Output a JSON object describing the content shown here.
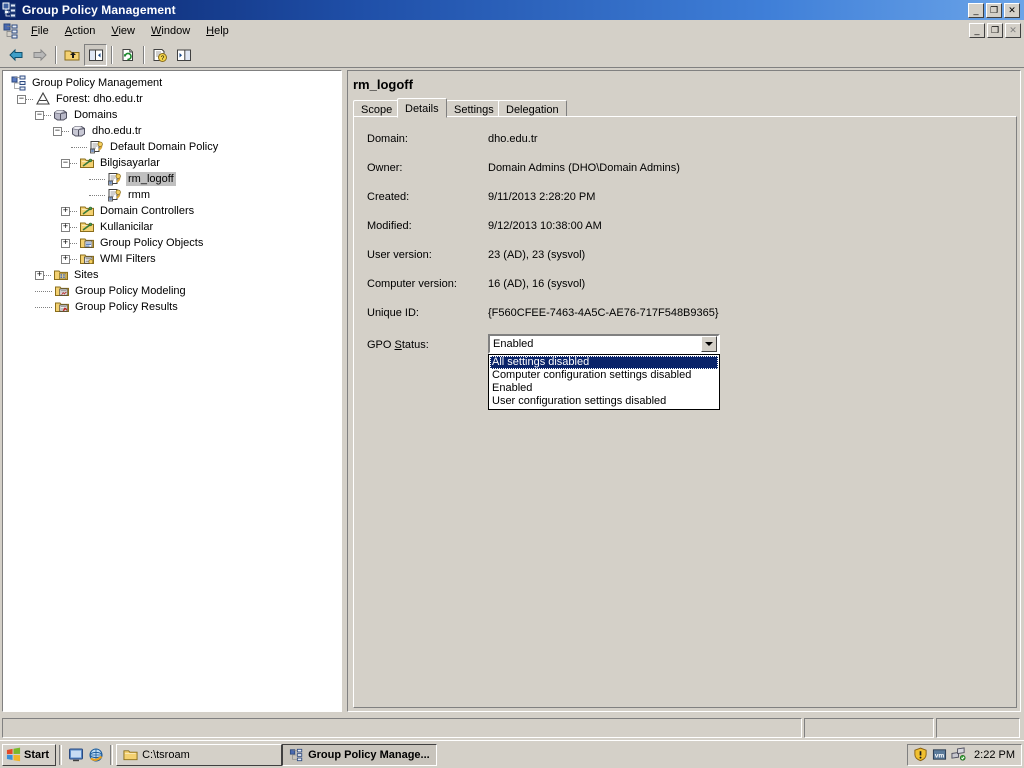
{
  "window": {
    "title": "Group Policy Management",
    "icon": "gpmc-icon",
    "controls": {
      "minimize": "_",
      "maximize": "❐",
      "close": "✕"
    }
  },
  "mdi_controls": {
    "minimize": "_",
    "maximize": "❐",
    "close": "✕"
  },
  "menu": {
    "icon": "gpmc-small-icon",
    "items": [
      {
        "label": "File",
        "accel": "F"
      },
      {
        "label": "Action",
        "accel": "A"
      },
      {
        "label": "View",
        "accel": "V"
      },
      {
        "label": "Window",
        "accel": "W"
      },
      {
        "label": "Help",
        "accel": "H"
      }
    ]
  },
  "toolbar": {
    "buttons": [
      {
        "name": "back-button",
        "icon": "arrow-left-icon",
        "enabled": true,
        "pressed": false
      },
      {
        "name": "forward-button",
        "icon": "arrow-right-icon",
        "enabled": false,
        "pressed": false
      },
      {
        "name": "up-one-level-button",
        "icon": "up-folder-icon",
        "enabled": true,
        "pressed": false
      },
      {
        "name": "show-hide-tree-button",
        "icon": "console-tree-icon",
        "enabled": true,
        "pressed": true
      },
      {
        "name": "refresh-button",
        "icon": "refresh-icon",
        "enabled": true,
        "pressed": false
      },
      {
        "name": "help-button",
        "icon": "help-icon",
        "enabled": true,
        "pressed": false
      },
      {
        "name": "show-action-pane-button",
        "icon": "action-pane-icon",
        "enabled": true,
        "pressed": false
      }
    ]
  },
  "tree": {
    "nodes": [
      {
        "label": "Group Policy Management",
        "indent": 0,
        "expander": "none",
        "icon": "gpmc-root-icon",
        "selected": false
      },
      {
        "label": "Forest: dho.edu.tr",
        "indent": 1,
        "expander": "minus",
        "icon": "forest-icon",
        "selected": false
      },
      {
        "label": "Domains",
        "indent": 2,
        "expander": "minus",
        "icon": "domains-icon",
        "selected": false
      },
      {
        "label": "dho.edu.tr",
        "indent": 3,
        "expander": "minus",
        "icon": "domain-icon",
        "selected": false
      },
      {
        "label": "Default Domain Policy",
        "indent": 4,
        "expander": "none",
        "icon": "gpo-link-icon",
        "selected": false
      },
      {
        "label": "Bilgisayarlar",
        "indent": 4,
        "expander": "minus",
        "icon": "ou-icon",
        "selected": false
      },
      {
        "label": "rm_logoff",
        "indent": 5,
        "expander": "none",
        "icon": "gpo-link-icon",
        "selected": true
      },
      {
        "label": "rmm",
        "indent": 5,
        "expander": "none",
        "icon": "gpo-link-icon",
        "selected": false
      },
      {
        "label": "Domain Controllers",
        "indent": 4,
        "expander": "plus",
        "icon": "ou-icon",
        "selected": false
      },
      {
        "label": "Kullanicilar",
        "indent": 4,
        "expander": "plus",
        "icon": "ou-icon",
        "selected": false
      },
      {
        "label": "Group Policy Objects",
        "indent": 4,
        "expander": "plus",
        "icon": "gpo-folder-icon",
        "selected": false
      },
      {
        "label": "WMI Filters",
        "indent": 4,
        "expander": "plus",
        "icon": "wmi-filter-icon",
        "selected": false
      },
      {
        "label": "Sites",
        "indent": 2,
        "expander": "plus",
        "icon": "sites-icon",
        "selected": false
      },
      {
        "label": "Group Policy Modeling",
        "indent": 2,
        "expander": "none",
        "icon": "gp-modeling-icon",
        "selected": false
      },
      {
        "label": "Group Policy Results",
        "indent": 2,
        "expander": "none",
        "icon": "gp-results-icon",
        "selected": false
      }
    ]
  },
  "details": {
    "title": "rm_logoff",
    "tabs": [
      {
        "label": "Scope",
        "active": false
      },
      {
        "label": "Details",
        "active": true
      },
      {
        "label": "Settings",
        "active": false
      },
      {
        "label": "Delegation",
        "active": false
      }
    ],
    "rows": [
      {
        "label": "Domain:",
        "value": "dho.edu.tr"
      },
      {
        "label": "Owner:",
        "value": "Domain Admins (DHO\\Domain Admins)"
      },
      {
        "label": "Created:",
        "value": "9/11/2013 2:28:20 PM"
      },
      {
        "label": "Modified:",
        "value": "9/12/2013 10:38:00 AM"
      },
      {
        "label": "User version:",
        "value": "23 (AD), 23 (sysvol)"
      },
      {
        "label": "Computer version:",
        "value": "16 (AD), 16 (sysvol)"
      },
      {
        "label": "Unique ID:",
        "value": "{F560CFEE-7463-4A5C-AE76-717F548B9365}"
      }
    ],
    "gpo_status": {
      "label_before": "GPO ",
      "label_accel": "S",
      "label_after": "tatus:",
      "selected_value": "Enabled",
      "expanded": true,
      "options": [
        {
          "label": "All settings disabled",
          "highlighted": true
        },
        {
          "label": "Computer configuration settings disabled",
          "highlighted": false
        },
        {
          "label": "Enabled",
          "highlighted": false
        },
        {
          "label": "User configuration settings disabled",
          "highlighted": false
        }
      ]
    }
  },
  "statusbar": {
    "pane1": "",
    "pane2": "",
    "pane3": ""
  },
  "taskbar": {
    "start_label": "Start",
    "quick_launch": [
      {
        "name": "show-desktop-icon"
      },
      {
        "name": "internet-explorer-icon"
      }
    ],
    "tasks": [
      {
        "label": "C:\\tsroam",
        "icon": "folder-icon",
        "active": false
      },
      {
        "label": "Group Policy Manage...",
        "icon": "gpmc-small-icon",
        "active": true
      }
    ],
    "tray": {
      "icons": [
        {
          "name": "security-warning-icon"
        },
        {
          "name": "vm-tools-icon"
        },
        {
          "name": "network-connection-icon"
        }
      ],
      "clock": "2:22 PM"
    }
  },
  "colors": {
    "title_start": "#0a246a",
    "title_end": "#6ba4e8",
    "face": "#d4d0c8",
    "selection": "#0a246a",
    "inactive_selection": "#c0c0c0",
    "folder_yellow": "#f8d86a"
  }
}
